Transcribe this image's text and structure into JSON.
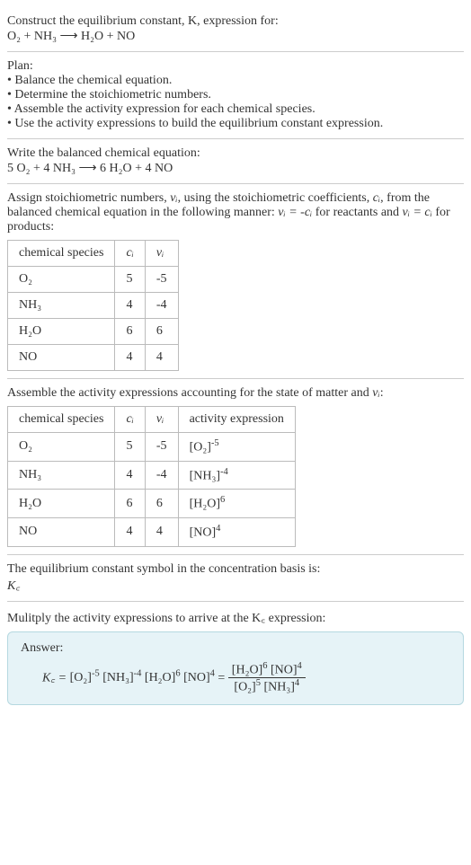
{
  "header": {
    "prompt_line1": "Construct the equilibrium constant, K, expression for:",
    "eq_unbalanced": "O₂ + NH₃ ⟶ H₂O + NO"
  },
  "plan": {
    "title": "Plan:",
    "b1": "• Balance the chemical equation.",
    "b2": "• Determine the stoichiometric numbers.",
    "b3": "• Assemble the activity expression for each chemical species.",
    "b4": "• Use the activity expressions to build the equilibrium constant expression."
  },
  "balanced": {
    "title": "Write the balanced chemical equation:",
    "eq": "5 O₂ + 4 NH₃ ⟶ 6 H₂O + 4 NO"
  },
  "stoich": {
    "intro_a": "Assign stoichiometric numbers, ",
    "intro_b": ", using the stoichiometric coefficients, ",
    "intro_c": ", from the balanced chemical equation in the following manner: ",
    "intro_d": " for reactants and ",
    "intro_e": " for products:",
    "nu_i": "νᵢ",
    "c_i": "cᵢ",
    "rel_react": "νᵢ = -cᵢ",
    "rel_prod": "νᵢ = cᵢ",
    "headers": {
      "species": "chemical species",
      "ci": "cᵢ",
      "vi": "νᵢ"
    },
    "rows": [
      {
        "sp": "O₂",
        "ci": "5",
        "vi": "-5"
      },
      {
        "sp": "NH₃",
        "ci": "4",
        "vi": "-4"
      },
      {
        "sp": "H₂O",
        "ci": "6",
        "vi": "6"
      },
      {
        "sp": "NO",
        "ci": "4",
        "vi": "4"
      }
    ]
  },
  "activity": {
    "intro_a": "Assemble the activity expressions accounting for the state of matter and ",
    "intro_b": ":",
    "nu_i": "νᵢ",
    "headers": {
      "species": "chemical species",
      "ci": "cᵢ",
      "vi": "νᵢ",
      "act": "activity expression"
    },
    "rows": [
      {
        "sp": "O₂",
        "ci": "5",
        "vi": "-5",
        "base": "[O₂]",
        "exp": "-5"
      },
      {
        "sp": "NH₃",
        "ci": "4",
        "vi": "-4",
        "base": "[NH₃]",
        "exp": "-4"
      },
      {
        "sp": "H₂O",
        "ci": "6",
        "vi": "6",
        "base": "[H₂O]",
        "exp": "6"
      },
      {
        "sp": "NO",
        "ci": "4",
        "vi": "4",
        "base": "[NO]",
        "exp": "4"
      }
    ]
  },
  "kc_symbol": {
    "line1": "The equilibrium constant symbol in the concentration basis is:",
    "symbol": "K꜀"
  },
  "multiply": {
    "line": "Mulitply the activity expressions to arrive at the K꜀ expression:"
  },
  "answer": {
    "label": "Answer:",
    "lhs": "K꜀ = ",
    "t1b": "[O₂]",
    "t1e": "-5",
    "t2b": "[NH₃]",
    "t2e": "-4",
    "t3b": "[H₂O]",
    "t3e": "6",
    "t4b": "[NO]",
    "t4e": "4",
    "eq": " = ",
    "num1b": "[H₂O]",
    "num1e": "6",
    "num2b": "[NO]",
    "num2e": "4",
    "den1b": "[O₂]",
    "den1e": "5",
    "den2b": "[NH₃]",
    "den2e": "4"
  }
}
